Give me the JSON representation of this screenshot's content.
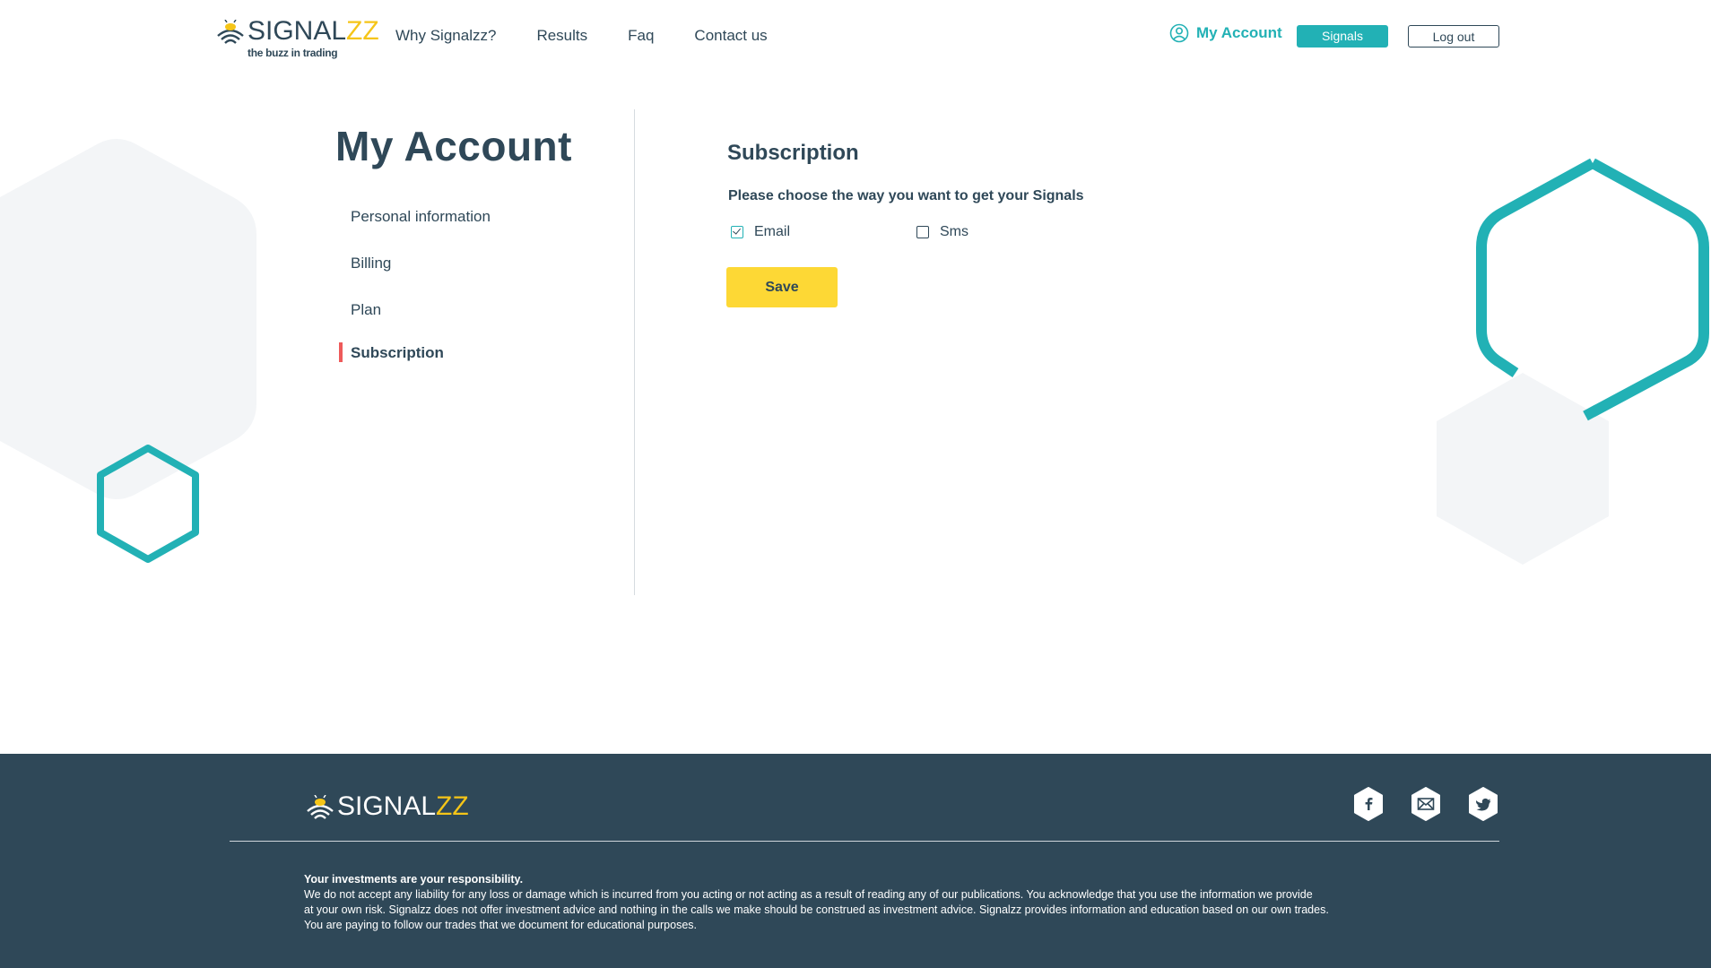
{
  "brand": {
    "name_part1": "SIGNAL",
    "name_part2": "ZZ",
    "tagline": "the buzz in trading"
  },
  "nav": {
    "items": [
      {
        "label": "Why Signalzz?"
      },
      {
        "label": "Results"
      },
      {
        "label": "Faq"
      },
      {
        "label": "Contact us"
      }
    ],
    "account_label": "My Account",
    "signals_label": "Signals",
    "logout_label": "Log out"
  },
  "account": {
    "title": "My Account",
    "menu": [
      {
        "label": "Personal information"
      },
      {
        "label": "Billing"
      },
      {
        "label": "Plan"
      },
      {
        "label": "Subscription",
        "active": true
      }
    ]
  },
  "subscription": {
    "title": "Subscription",
    "question": "Please choose the way you want to get your Signals",
    "options": [
      {
        "label": "Email",
        "checked": true
      },
      {
        "label": "Sms",
        "checked": false
      }
    ],
    "save_label": "Save"
  },
  "footer": {
    "socials": [
      "facebook-icon",
      "mail-icon",
      "twitter-icon"
    ],
    "disclaimer_head": "Your investments are your responsibility.",
    "disclaimer_lines": [
      "We do not accept any liability for any loss or damage which is incurred from you acting or not acting as a result of reading any of our publications. You acknowledge that you use the information we provide",
      "at your own risk. Signalzz does not offer investment advice and nothing in the calls we make should be construed as investment advice. Signalzz provides information and education based on our own trades.",
      "You are paying to follow our trades that we document for educational purposes."
    ]
  },
  "colors": {
    "teal": "#22b1b5",
    "navy": "#2f4858",
    "yellow": "#fdd835",
    "active_marker": "#ee5a5a",
    "hex_grey": "#f3f5f7"
  }
}
